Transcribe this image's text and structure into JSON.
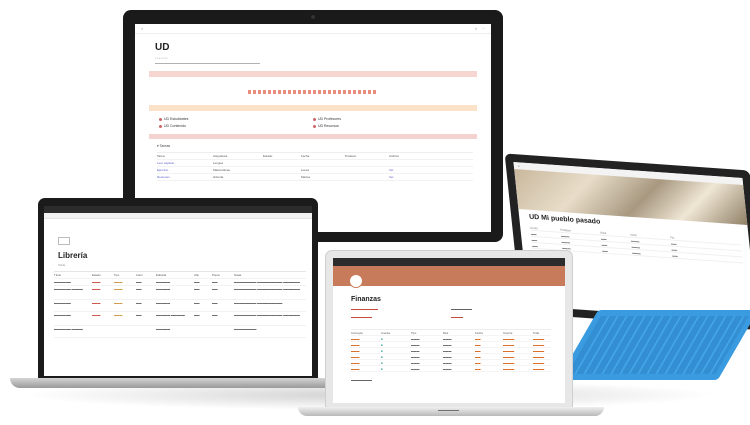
{
  "devices": {
    "monitor": {
      "page_title": "UD",
      "banner_motif": "decorative-dots",
      "grid_items": [
        "UD Estudiantes",
        "UD Profesores",
        "UD Contenido",
        "UD Recursos"
      ],
      "section_label": "Tareas",
      "table_rows": [
        [
          "Tarea",
          "Asignatura",
          "Estado",
          "Fecha",
          "Profesor",
          "Archivo"
        ],
        [
          "Leer capítulo",
          "Lengua",
          "",
          "",
          "",
          ""
        ],
        [
          "Ejercicio",
          "Matemáticas",
          "",
          "Lunes",
          "",
          "Ver"
        ],
        [
          "Resumen",
          "Historia",
          "",
          "Martes",
          "",
          "Ver"
        ]
      ]
    },
    "tablet": {
      "page_title": "UD Mi pueblo pasado",
      "rows": [
        [
          "Curso",
          "Profesor",
          "Área",
          "Inicio",
          "Fin"
        ],
        [
          "",
          "",
          "",
          "",
          ""
        ],
        [
          "",
          "",
          "",
          "",
          ""
        ],
        [
          "",
          "",
          "",
          "",
          ""
        ]
      ]
    },
    "laptop_left": {
      "page_title": "Librería",
      "view_label": "Tabla",
      "table_rows": [
        [
          "Título",
          "Estado",
          "Tipo",
          "Autor",
          "Editorial",
          "Año",
          "Precio",
          "Notas"
        ],
        [
          "",
          "",
          "",
          "",
          "",
          "",
          "",
          ""
        ],
        [
          "",
          "",
          "",
          "",
          "",
          "",
          "",
          ""
        ],
        [
          "",
          "",
          "",
          "",
          "",
          "",
          "",
          ""
        ],
        [
          "",
          "",
          "",
          "",
          "",
          "",
          "",
          ""
        ],
        [
          "",
          "",
          "",
          "",
          "",
          "",
          "",
          ""
        ]
      ]
    },
    "laptop_center": {
      "page_title": "Finanzas",
      "meta_left": "",
      "meta_right": "",
      "table_rows": [
        [
          "Concepto",
          "Cuenta",
          "Tipo",
          "Mes",
          "Fecha",
          "Importe",
          "Total"
        ],
        [
          "",
          "",
          "",
          "",
          "",
          "",
          ""
        ],
        [
          "",
          "",
          "",
          "",
          "",
          "",
          ""
        ],
        [
          "",
          "",
          "",
          "",
          "",
          "",
          ""
        ],
        [
          "",
          "",
          "",
          "",
          "",
          "",
          ""
        ],
        [
          "",
          "",
          "",
          "",
          "",
          "",
          ""
        ],
        [
          "",
          "",
          "",
          "",
          "",
          "",
          ""
        ]
      ],
      "footer": "",
      "base_label": ""
    }
  },
  "colors": {
    "accent_pink": "#f7d6d2",
    "accent_peach": "#fbe2c8",
    "finance_cover": "#c87b5b",
    "keyboard_blue": "#3a9be0",
    "link_purple": "#5b60c4"
  }
}
